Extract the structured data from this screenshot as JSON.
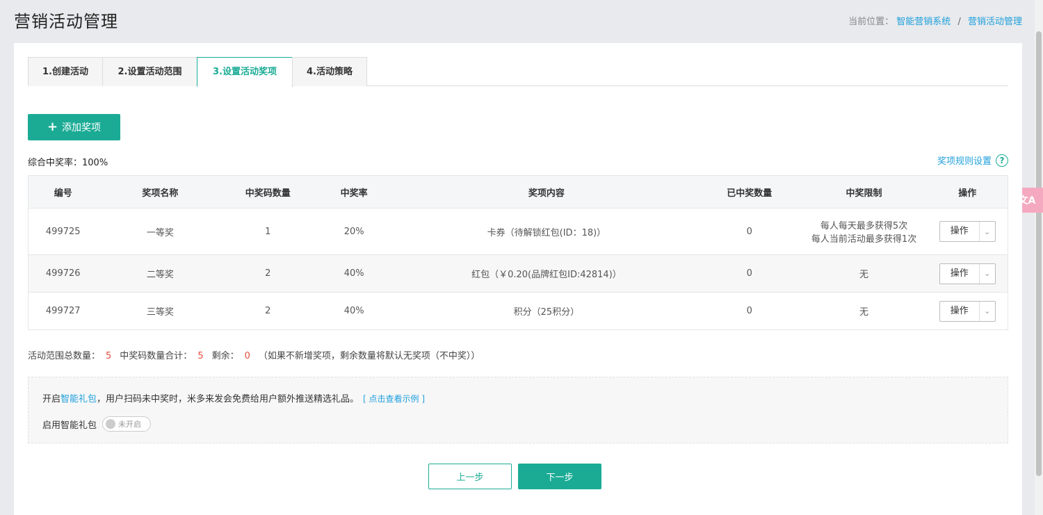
{
  "header": {
    "title": "营销活动管理",
    "breadcrumb_prefix": "当前位置：",
    "breadcrumb": [
      "智能营销系统",
      "营销活动管理"
    ],
    "breadcrumb_sep": "/"
  },
  "tabs": [
    {
      "label": "1.创建活动"
    },
    {
      "label": "2.设置活动范围"
    },
    {
      "label": "3.设置活动奖项"
    },
    {
      "label": "4.活动策略"
    }
  ],
  "add_button": "添加奖项",
  "overall_rate": "综合中奖率：100%",
  "rules_link": "奖项规则设置",
  "table": {
    "headers": [
      "编号",
      "奖项名称",
      "中奖码数量",
      "中奖率",
      "奖项内容",
      "已中奖数量",
      "中奖限制",
      "操作"
    ],
    "rows": [
      {
        "id": "499725",
        "name": "一等奖",
        "codes": "1",
        "rate": "20%",
        "content": "卡券（待解锁红包(ID：18)）",
        "won": "0",
        "limit1": "每人每天最多获得5次",
        "limit2": "每人当前活动最多获得1次",
        "op": "操作"
      },
      {
        "id": "499726",
        "name": "二等奖",
        "codes": "2",
        "rate": "40%",
        "content": "红包（￥0.20(品牌红包ID:42814)）",
        "won": "0",
        "limit1": "无",
        "limit2": "",
        "op": "操作"
      },
      {
        "id": "499727",
        "name": "三等奖",
        "codes": "2",
        "rate": "40%",
        "content": "积分（25积分）",
        "won": "0",
        "limit1": "无",
        "limit2": "",
        "op": "操作"
      }
    ]
  },
  "summary": {
    "total_label": "活动范围总数量：",
    "total_value": "5",
    "codes_label": "中奖码数量合计：",
    "codes_value": "5",
    "remain_label": "剩余：",
    "remain_value": "0",
    "note": "（如果不新增奖项，剩余数量将默认无奖项（不中奖））"
  },
  "gift": {
    "prefix": "开启",
    "highlight": "智能礼包",
    "text": "，用户扫码未中奖时，米多来发会免费给用户额外推送精选礼品。",
    "example": "[ 点击查看示例 ]",
    "toggle_label": "启用智能礼包",
    "toggle_state": "未开启"
  },
  "buttons": {
    "prev": "上一步",
    "next": "下一步"
  },
  "translate_float": "文A"
}
